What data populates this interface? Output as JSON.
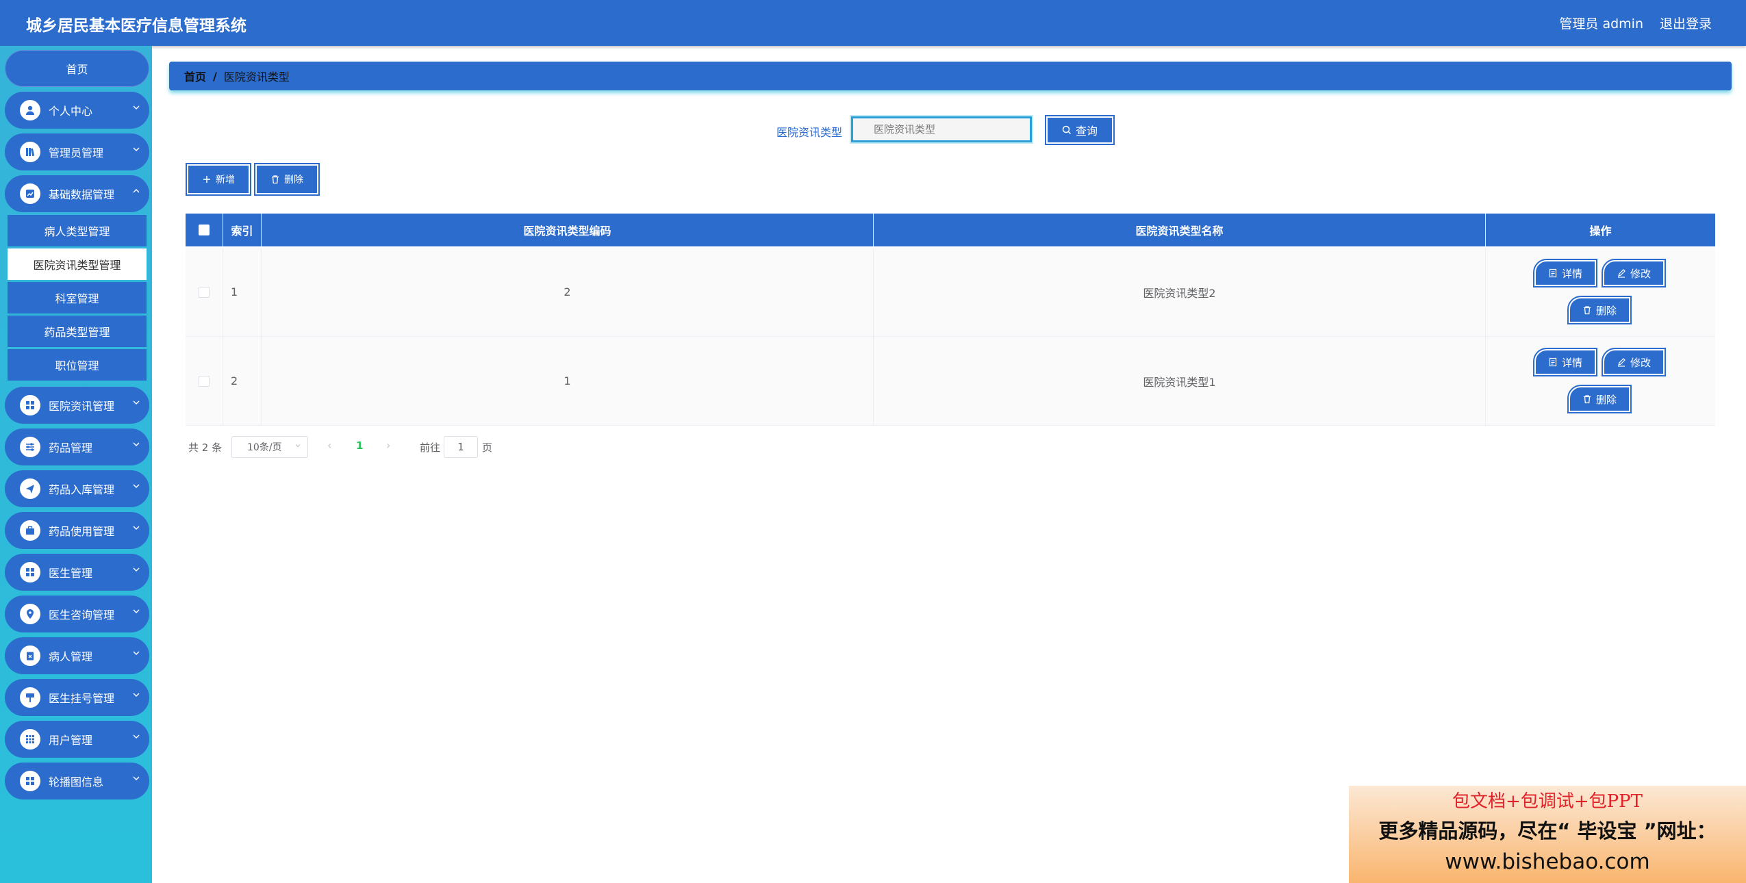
{
  "header": {
    "title": "城乡居民基本医疗信息管理系统",
    "admin_label": "管理员 admin",
    "logout": "退出登录"
  },
  "sidebar": {
    "home": "首页",
    "groups": [
      {
        "label": "个人中心",
        "icon": "user-icon"
      },
      {
        "label": "管理员管理",
        "icon": "book-icon"
      },
      {
        "label": "基础数据管理",
        "icon": "chart-icon"
      }
    ],
    "sub_items": [
      {
        "label": "病人类型管理",
        "active": false
      },
      {
        "label": "医院资讯类型管理",
        "active": true
      },
      {
        "label": "科室管理",
        "active": false
      },
      {
        "label": "药品类型管理",
        "active": false
      },
      {
        "label": "职位管理",
        "active": false
      }
    ],
    "groups_after": [
      {
        "label": "医院资讯管理",
        "icon": "grid-icon"
      },
      {
        "label": "药品管理",
        "icon": "sliders-icon"
      },
      {
        "label": "药品入库管理",
        "icon": "send-icon"
      },
      {
        "label": "药品使用管理",
        "icon": "briefcase-icon"
      },
      {
        "label": "医生管理",
        "icon": "grid-icon"
      },
      {
        "label": "医生咨询管理",
        "icon": "location-icon"
      },
      {
        "label": "病人管理",
        "icon": "clipboard-icon"
      },
      {
        "label": "医生挂号管理",
        "icon": "sign-icon"
      },
      {
        "label": "用户管理",
        "icon": "apps-icon"
      },
      {
        "label": "轮播图信息",
        "icon": "grid-icon"
      }
    ]
  },
  "breadcrumb": {
    "home": "首页",
    "sep": "/",
    "current": "医院资讯类型"
  },
  "search": {
    "label": "医院资讯类型",
    "placeholder": "医院资讯类型",
    "query_button": "查询"
  },
  "toolbar": {
    "add_label": "新增",
    "delete_label": "删除"
  },
  "table": {
    "columns": [
      "索引",
      "医院资讯类型编码",
      "医院资讯类型名称",
      "操作"
    ],
    "rows": [
      {
        "index": "1",
        "code": "2",
        "name": "医院资讯类型2"
      },
      {
        "index": "2",
        "code": "1",
        "name": "医院资讯类型1"
      }
    ],
    "actions": {
      "detail": "详情",
      "edit": "修改",
      "delete": "删除"
    }
  },
  "pagination": {
    "total": "共 2 条",
    "page_size": "10条/页",
    "prev": "‹",
    "current_page": "1",
    "next": "›",
    "goto_label": "前往",
    "goto_value": "1",
    "page_suffix": "页"
  },
  "watermark": {
    "line1": "包文档+包调试+包PPT",
    "line2": "更多精品源码，尽在“ 毕设宝 ”网址：",
    "line3": "www.bishebao.com"
  },
  "colors": {
    "primary": "#2b6ccd",
    "sidebar": "#2ac0db",
    "page_active": "#2ac05b"
  }
}
